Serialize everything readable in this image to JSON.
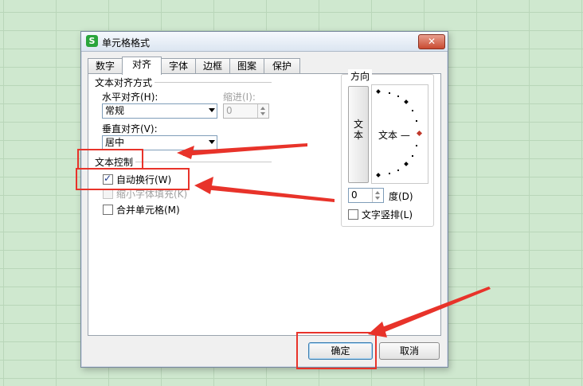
{
  "dialog": {
    "title": "单元格格式",
    "app_icon_letter": "S",
    "close_symbol": "✕",
    "tabs": [
      {
        "label": "数字"
      },
      {
        "label": "对齐"
      },
      {
        "label": "字体"
      },
      {
        "label": "边框"
      },
      {
        "label": "图案"
      },
      {
        "label": "保护"
      }
    ],
    "active_tab": "对齐"
  },
  "alignment": {
    "title": "文本对齐方式",
    "horizontal_label": "水平对齐(H):",
    "horizontal_value": "常规",
    "indent_label": "缩进(I):",
    "indent_value": "0",
    "vertical_label": "垂直对齐(V):",
    "vertical_value": "居中"
  },
  "text_control": {
    "title": "文本控制",
    "wrap_text": {
      "label": "自动换行(W)",
      "checked": true
    },
    "shrink_to_fit": {
      "label": "缩小字体填充(K)",
      "checked": false,
      "disabled": true
    },
    "merge_cells": {
      "label": "合并单元格(M)",
      "checked": false
    }
  },
  "orientation": {
    "title": "方向",
    "vertical_text_chars": [
      "文",
      "本"
    ],
    "dial_text": "文本 —",
    "degree_value": "0",
    "degree_label": "度(D)",
    "vertical_text_label": "文字竖排(L)",
    "vertical_text_checked": false
  },
  "buttons": {
    "ok": "确定",
    "cancel": "取消"
  },
  "colors": {
    "annotation_red": "#e8332a",
    "dial_indicator": "#c0392b"
  }
}
